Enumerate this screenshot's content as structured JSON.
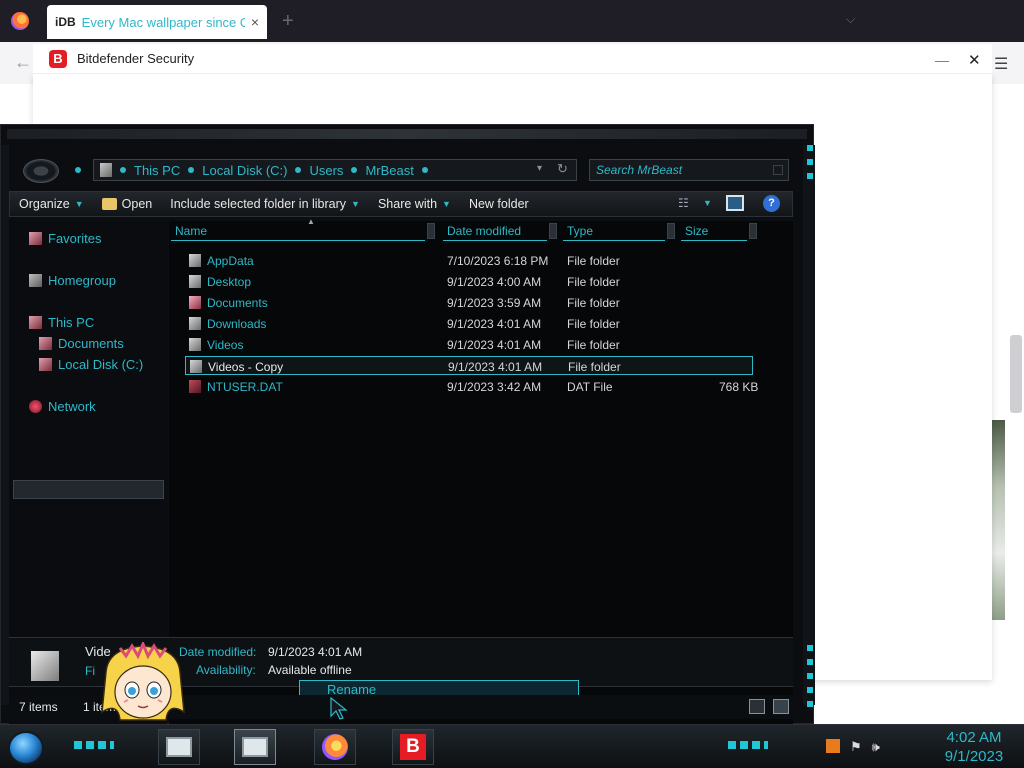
{
  "browser": {
    "tab_favicon": "iDB",
    "tab_title": "Every Mac wallpaper since OS",
    "tab_close": "×",
    "new_tab": "+",
    "tab_list": "⌵",
    "back": "←",
    "menu": "☰"
  },
  "bitdefender": {
    "logo_letter": "B",
    "title": "Bitdefender Security",
    "minimize": "—",
    "close": "✕"
  },
  "explorer": {
    "breadcrumb": [
      "This PC",
      "Local Disk (C:)",
      "Users",
      "MrBeast"
    ],
    "search_placeholder": "Search MrBeast",
    "toolbar": {
      "organize": "Organize",
      "open": "Open",
      "include": "Include selected folder in library",
      "share": "Share with",
      "new_folder": "New folder",
      "help": "?"
    },
    "nav": {
      "favorites": "Favorites",
      "homegroup": "Homegroup",
      "this_pc": "This PC",
      "documents": "Documents",
      "local_disk": "Local Disk (C:)",
      "network": "Network"
    },
    "columns": {
      "name": "Name",
      "date": "Date modified",
      "type": "Type",
      "size": "Size"
    },
    "files": [
      {
        "name": "AppData",
        "date": "7/10/2023 6:18 PM",
        "type": "File folder",
        "size": ""
      },
      {
        "name": "Desktop",
        "date": "9/1/2023 4:00 AM",
        "type": "File folder",
        "size": ""
      },
      {
        "name": "Documents",
        "date": "9/1/2023 3:59 AM",
        "type": "File folder",
        "size": ""
      },
      {
        "name": "Downloads",
        "date": "9/1/2023 4:01 AM",
        "type": "File folder",
        "size": ""
      },
      {
        "name": "Videos",
        "date": "9/1/2023 4:01 AM",
        "type": "File folder",
        "size": ""
      },
      {
        "name": "Videos - Copy",
        "date": "9/1/2023 4:01 AM",
        "type": "File folder",
        "size": ""
      },
      {
        "name": "NTUSER.DAT",
        "date": "9/1/2023 3:42 AM",
        "type": "DAT File",
        "size": "768 KB"
      }
    ],
    "details": {
      "name_partial": "Vide",
      "fi_partial": "Fi",
      "date_label": "Date modified:",
      "date_value": "9/1/2023 4:01 AM",
      "avail_label": "Availability:",
      "avail_value": "Available offline"
    },
    "context_menu": {
      "rename": "Rename"
    },
    "status": {
      "item_count": "7 items",
      "selected_partial": "1 item"
    }
  },
  "taskbar": {
    "bitdefender_letter": "B",
    "time": "4:02 AM",
    "date": "9/1/2023",
    "tray_flag": "⚑",
    "tray_volume": "🕪"
  },
  "colors": {
    "accent": "#2fb8c8",
    "explorer_bg": "#0b0d10",
    "bitdefender_red": "#e51c23"
  }
}
